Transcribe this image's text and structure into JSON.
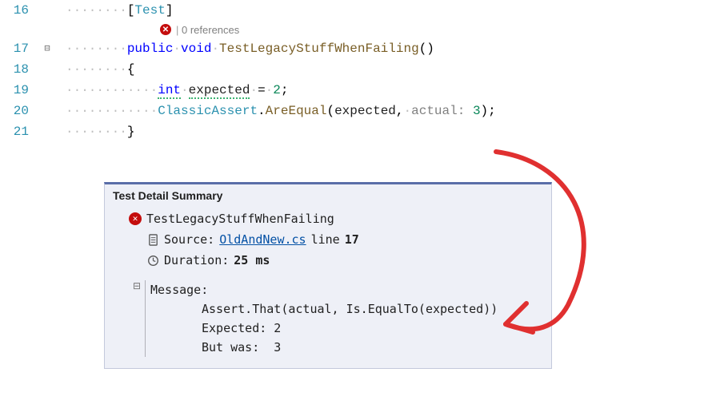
{
  "editor": {
    "lines": [
      {
        "num": 16,
        "fold": "",
        "dots": 8,
        "tokens": "[<span class='tok-attr'>Test</span>]"
      },
      {
        "num": 17,
        "fold": "⊟",
        "dots": 8,
        "tokens": "<span class='tok-key'>public</span><span class='ws-dot'>·</span><span class='tok-key'>void</span><span class='ws-dot'>·</span><span class='tok-method'>TestLegacyStuffWhenFailing</span>()"
      },
      {
        "num": 18,
        "fold": "",
        "dots": 8,
        "tokens": "{"
      },
      {
        "num": 19,
        "fold": "",
        "dots": 12,
        "tokens": "<span class='tok-key dotted-ul'>int</span><span class='ws-dot'>·</span><span class='tok-ident dotted-ul'>expected</span><span class='ws-dot'>·</span>=<span class='ws-dot'>·</span><span class='tok-num'>2</span>;"
      },
      {
        "num": 20,
        "fold": "",
        "dots": 12,
        "tokens": "<span class='tok-type'>ClassicAssert</span>.<span class='tok-method'>AreEqual</span>(<span class='tok-ident'>expected</span>,<span class='ws-dot'>·</span><span class='tok-param'>actual:</span><span class='ws-dot'> </span><span class='tok-num'>3</span>);"
      },
      {
        "num": 21,
        "fold": "",
        "dots": 8,
        "tokens": "}"
      }
    ],
    "codelens": {
      "references": "0 references"
    }
  },
  "panel": {
    "title": "Test Detail Summary",
    "testName": "TestLegacyStuffWhenFailing",
    "sourceLabel": "Source:",
    "sourceFile": "OldAndNew.cs",
    "sourceLineWord": "line",
    "sourceLine": "17",
    "durationLabel": "Duration:",
    "duration": "25 ms",
    "messageLabel": "Message:",
    "messageLines": [
      "Assert.That(actual, Is.EqualTo(expected))",
      "Expected: 2",
      "But was:  3"
    ]
  },
  "colors": {
    "accentRed": "#c40d0d",
    "arrow": "#e03030"
  }
}
